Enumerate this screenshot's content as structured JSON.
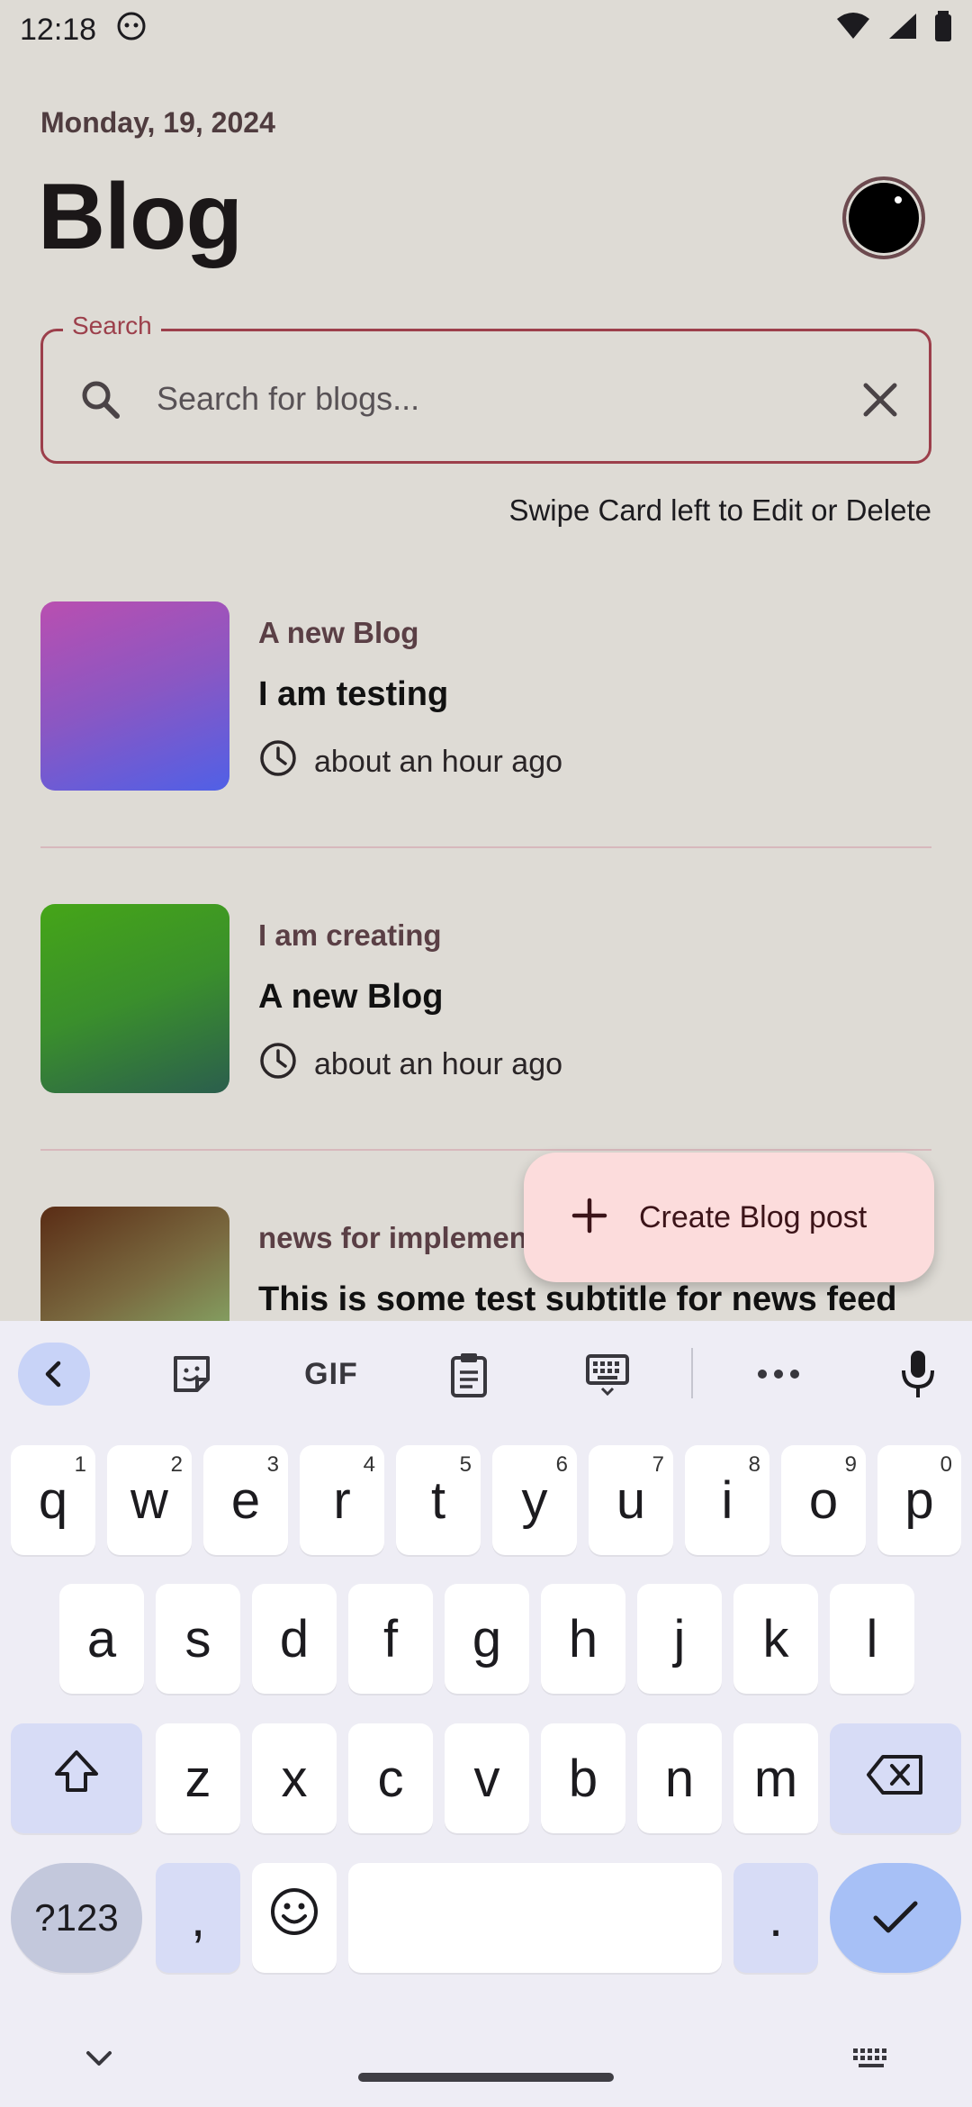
{
  "status_bar": {
    "time": "12:18"
  },
  "header": {
    "date": "Monday, 19, 2024",
    "title": "Blog"
  },
  "search": {
    "label": "Search",
    "placeholder": "Search for blogs..."
  },
  "swipe_hint": "Swipe Card left to Edit or Delete",
  "blogs": [
    {
      "title": "A new Blog",
      "subtitle": "I am testing",
      "time": "about an hour ago"
    },
    {
      "title": "I am creating",
      "subtitle": "A new Blog",
      "time": "about an hour ago"
    },
    {
      "title": "news for implementation",
      "subtitle": "This is some test subtitle for news feed",
      "time": ""
    }
  ],
  "fab": {
    "label": "Create Blog post"
  },
  "keyboard": {
    "toolbar": [
      "chevron-left-icon",
      "sticker-icon",
      "gif-icon",
      "clipboard-icon",
      "keyboard-icon",
      "more-icon",
      "mic-icon"
    ],
    "gif_label": "GIF",
    "row1": [
      {
        "k": "q",
        "h": "1"
      },
      {
        "k": "w",
        "h": "2"
      },
      {
        "k": "e",
        "h": "3"
      },
      {
        "k": "r",
        "h": "4"
      },
      {
        "k": "t",
        "h": "5"
      },
      {
        "k": "y",
        "h": "6"
      },
      {
        "k": "u",
        "h": "7"
      },
      {
        "k": "i",
        "h": "8"
      },
      {
        "k": "o",
        "h": "9"
      },
      {
        "k": "p",
        "h": "0"
      }
    ],
    "row2": [
      "a",
      "s",
      "d",
      "f",
      "g",
      "h",
      "j",
      "k",
      "l"
    ],
    "row3": [
      "z",
      "x",
      "c",
      "v",
      "b",
      "n",
      "m"
    ],
    "symbols_label": "?123",
    "comma": ",",
    "period": "."
  },
  "colors": {
    "accent": "#9c3f4b",
    "fab_bg": "#fcdcdc",
    "background": "#dedbd5"
  }
}
